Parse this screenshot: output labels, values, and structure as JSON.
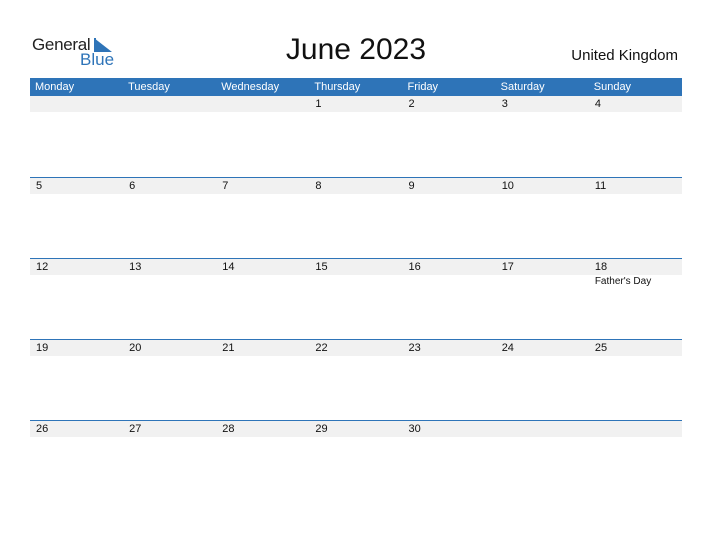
{
  "logo": {
    "text_general": "General",
    "text_blue": "Blue",
    "icon": "triangle-flag-icon"
  },
  "title": "June 2023",
  "country": "United Kingdom",
  "colors": {
    "accent": "#2e74b8",
    "daybar": "#f1f1f1"
  },
  "weekdays": [
    "Monday",
    "Tuesday",
    "Wednesday",
    "Thursday",
    "Friday",
    "Saturday",
    "Sunday"
  ],
  "weeks": [
    {
      "days": [
        "",
        "",
        "",
        "1",
        "2",
        "3",
        "4"
      ],
      "events": [
        "",
        "",
        "",
        "",
        "",
        "",
        ""
      ]
    },
    {
      "days": [
        "5",
        "6",
        "7",
        "8",
        "9",
        "10",
        "11"
      ],
      "events": [
        "",
        "",
        "",
        "",
        "",
        "",
        ""
      ]
    },
    {
      "days": [
        "12",
        "13",
        "14",
        "15",
        "16",
        "17",
        "18"
      ],
      "events": [
        "",
        "",
        "",
        "",
        "",
        "",
        "Father's Day"
      ]
    },
    {
      "days": [
        "19",
        "20",
        "21",
        "22",
        "23",
        "24",
        "25"
      ],
      "events": [
        "",
        "",
        "",
        "",
        "",
        "",
        ""
      ]
    },
    {
      "days": [
        "26",
        "27",
        "28",
        "29",
        "30",
        "",
        ""
      ],
      "events": [
        "",
        "",
        "",
        "",
        "",
        "",
        ""
      ]
    }
  ]
}
